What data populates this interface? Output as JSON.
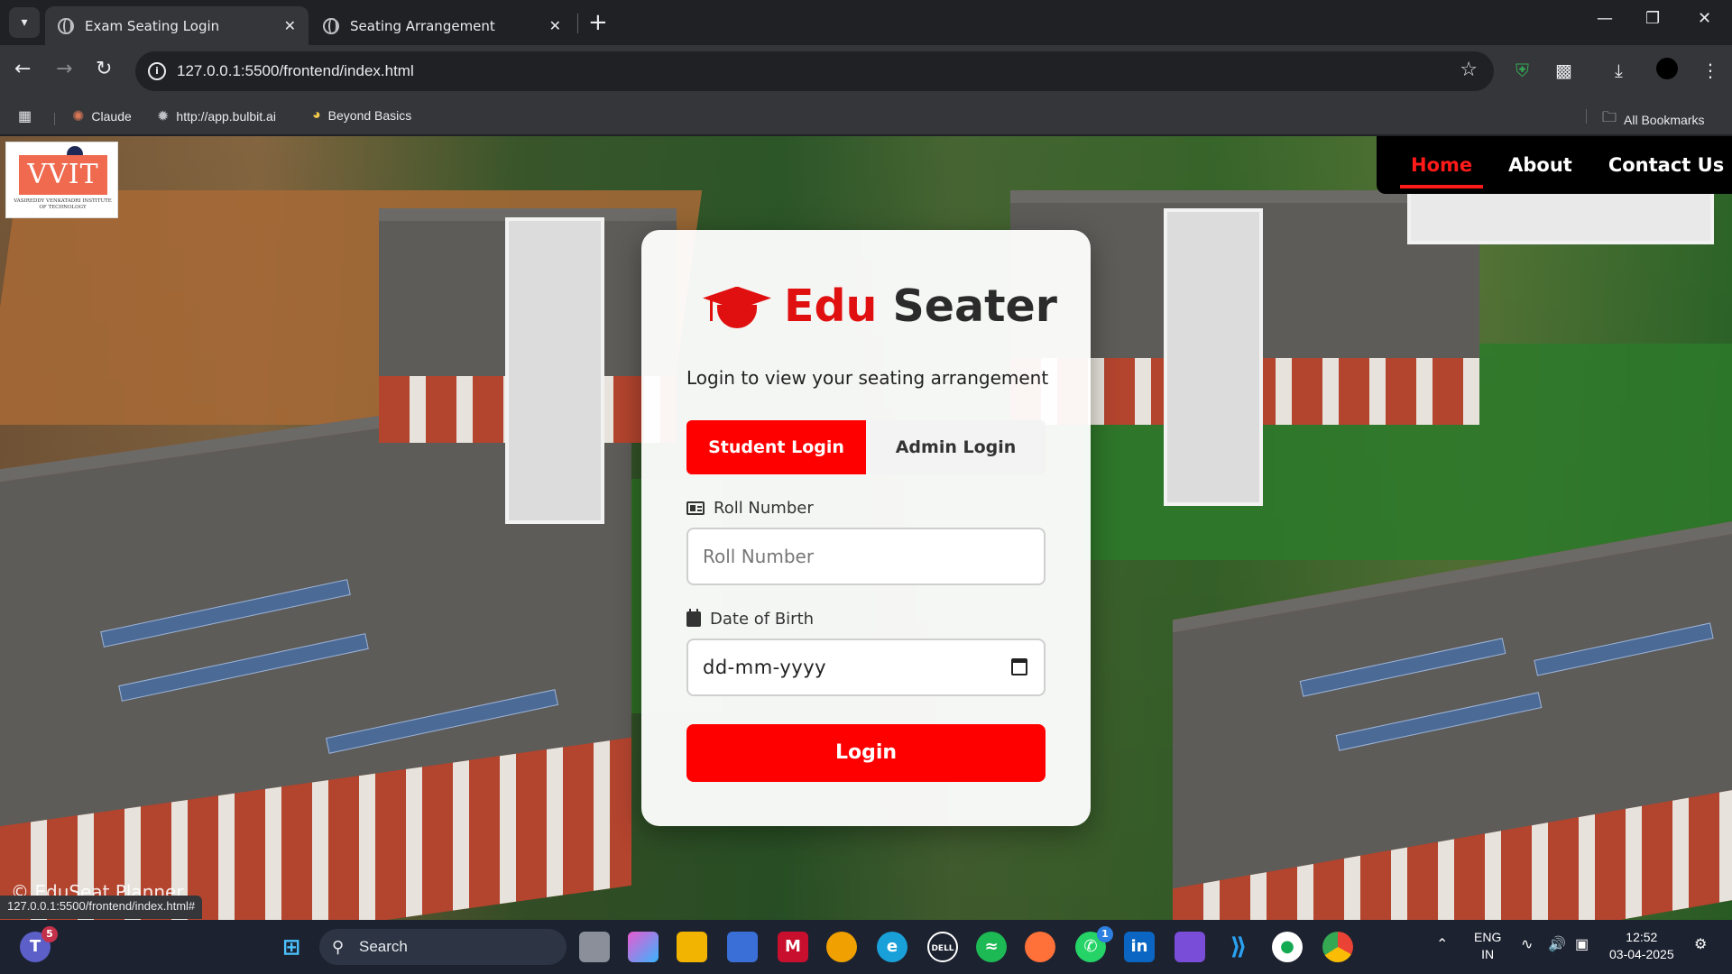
{
  "browser": {
    "tabs": [
      {
        "title": "Exam Seating Login",
        "active": true
      },
      {
        "title": "Seating Arrangement",
        "active": false
      }
    ],
    "new_tab_label": "+",
    "url": "127.0.0.1:5500/frontend/index.html",
    "bookmarks": [
      {
        "label": "Claude",
        "icon": "claude-icon"
      },
      {
        "label": "http://app.bulbit.ai",
        "icon": "bulbit-icon"
      },
      {
        "label": "Beyond Basics",
        "icon": "beyond-basics-icon"
      }
    ],
    "all_bookmarks": "All Bookmarks",
    "status_url": "127.0.0.1:5500/frontend/index.html#"
  },
  "page": {
    "logo": {
      "text": "VVIT",
      "subtext": "VASIREDDY VENKATADRI INSTITUTE OF TECHNOLOGY"
    },
    "nav": [
      {
        "label": "Home",
        "active": true
      },
      {
        "label": "About",
        "active": false
      },
      {
        "label": "Contact Us",
        "active": false
      }
    ],
    "footer": "© EduSeat Planner",
    "accent_color": "#ff0000"
  },
  "login": {
    "brand_part1": "Edu",
    "brand_part2": "Seater",
    "subtitle": "Login to view your seating arrangement",
    "tabs": {
      "student": "Student Login",
      "admin": "Admin Login",
      "selected": "student"
    },
    "roll_label": "Roll Number",
    "roll_placeholder": "Roll Number",
    "dob_label": "Date of Birth",
    "dob_value": "dd-mm-yyyy",
    "submit": "Login"
  },
  "taskbar": {
    "search_label": "Search",
    "teams_badge": "5",
    "whatsapp_badge": "1",
    "lang_top": "ENG",
    "lang_bottom": "IN",
    "time": "12:52",
    "date": "03-04-2025"
  }
}
